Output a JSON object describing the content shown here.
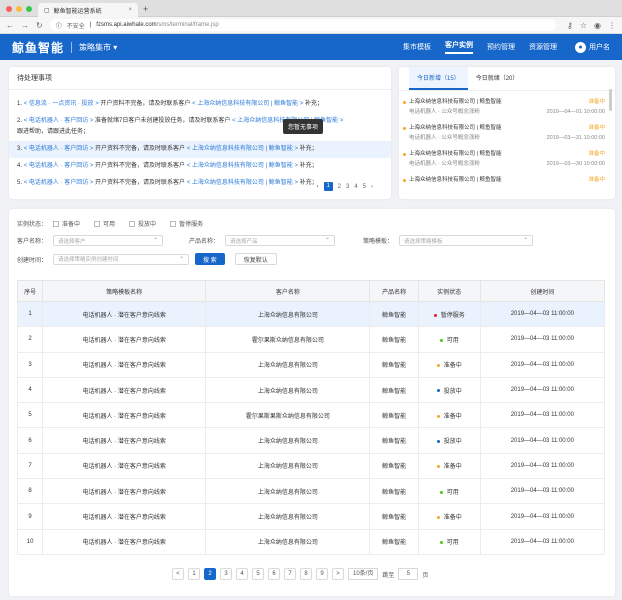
{
  "browser": {
    "tab_title": "鲸鱼智能运营系统",
    "insecure": "不安全",
    "url_host": "fzsms.api.aiwhale.com",
    "url_path": "/sms/terminal/frame.jsp"
  },
  "header": {
    "logo": "鲸鱼智能",
    "market": "策略集市",
    "nav": [
      "集市模板",
      "客户实例",
      "预约管理",
      "资源管理"
    ],
    "user": "用户名"
  },
  "todo": {
    "title": "待处理事项",
    "tooltip": "您暂无事项",
    "items": [
      {
        "n": "1.",
        "a": "< 信息流 · 一点资讯 · 投放 >",
        "b": "开户资料不完备，请及时联系客户",
        "c": "< 上海众纳信息科技有限公司 | 鲸鱼智能 >",
        "d": "补充；",
        "e": ""
      },
      {
        "n": "2.",
        "a": "< 电话机器人 · 客户回访 >",
        "b": "准备就绪7日客户未创建投放任务，请及时联系客户",
        "c": "< 上海众纳信息科技有限公司 | 鲸鱼智能 >",
        "d": "",
        "e": "跟进帮助，请跟进此任务；"
      },
      {
        "n": "3.",
        "a": "< 电话机器人 · 客户回访 >",
        "b": "开户资料不完备，请及时联系客户",
        "c": "< 上海众纳信息科技有限公司 | 鲸鱼智能 >",
        "d": "补充；",
        "e": ""
      },
      {
        "n": "4.",
        "a": "< 电话机器人 · 客户回访 >",
        "b": "开户资料不完备，请及时联系客户",
        "c": "< 上海众纳信息科技有限公司 | 鲸鱼智能 >",
        "d": "补充；",
        "e": ""
      },
      {
        "n": "5.",
        "a": "< 电话机器人 · 客户回访 >",
        "b": "开户资料不完备，请及时联系客户",
        "c": "< 上海众纳信息科技有限公司 | 鲸鱼智能 >",
        "d": "补充；",
        "e": ""
      }
    ],
    "pages": [
      "1",
      "2",
      "3",
      "4",
      "5"
    ]
  },
  "news": {
    "tab1": "今日新增（15）",
    "tab2": "今日就绪（20）",
    "items": [
      {
        "t": "上海众纳信息科技有限公司 | 鲸鱼智能",
        "s": "准备中",
        "sub": "电话机器人 · 公众号概念涨粉",
        "d": "2019—04—01 10:00:00"
      },
      {
        "t": "上海众纳信息科技有限公司 | 鲸鱼智能",
        "s": "准备中",
        "sub": "电话机器人 · 公众号概念涨粉",
        "d": "2019—03—31 10:00:00"
      },
      {
        "t": "上海众纳信息科技有限公司 | 鲸鱼智能",
        "s": "准备中",
        "sub": "电话机器人 · 公众号概念涨粉",
        "d": "2019—03—30 10:00:00"
      },
      {
        "t": "上海众纳信息科技有限公司 | 鲸鱼智能",
        "s": "准备中",
        "sub": "",
        "d": ""
      }
    ]
  },
  "filters": {
    "status_label": "实例状态：",
    "status_opts": [
      "准备中",
      "可用",
      "投放中",
      "暂停服务"
    ],
    "customer_label": "客户名称：",
    "customer_ph": "请选择客户",
    "product_label": "产品名称：",
    "product_ph": "请选择产品",
    "template_label": "策略模板：",
    "template_ph": "请选择策略模板",
    "time_label": "创建时间：",
    "time_ph": "请选择策略实例创建时间",
    "search": "搜 索",
    "reset": "恢复默认"
  },
  "table": {
    "headers": [
      "序号",
      "策略模板名称",
      "客户名称",
      "产品名称",
      "实例状态",
      "创建时间"
    ],
    "rows": [
      [
        "1",
        "电话机器人 · 潜在客户意向线索",
        "上海众纳信息有限公司",
        "鲸鱼智能",
        "暂停服务",
        "2019—04—03  11:00:00"
      ],
      [
        "2",
        "电话机器人 · 潜在客户意向线索",
        "霍尔果斯众纳信息有限公司",
        "鲸鱼智能",
        "可用",
        "2019—04—03  11:00:00"
      ],
      [
        "3",
        "电话机器人 · 潜在客户意向线索",
        "上海众纳信息有限公司",
        "鲸鱼智能",
        "准备中",
        "2019—04—03  11:00:00"
      ],
      [
        "4",
        "电话机器人 · 潜在客户意向线索",
        "上海众纳信息有限公司",
        "鲸鱼智能",
        "投放中",
        "2019—04—03  11:00:00"
      ],
      [
        "5",
        "电话机器人 · 潜在客户意向线索",
        "霍尔果斯果斯众纳信息有限公司",
        "鲸鱼智能",
        "准备中",
        "2019—04—03  11:00:00"
      ],
      [
        "6",
        "电话机器人 · 潜在客户意向线索",
        "上海众纳信息有限公司",
        "鲸鱼智能",
        "投放中",
        "2019—04—03  11:00:00"
      ],
      [
        "7",
        "电话机器人 · 潜在客户意向线索",
        "上海众纳信息有限公司",
        "鲸鱼智能",
        "准备中",
        "2019—04—03  11:00:00"
      ],
      [
        "8",
        "电话机器人 · 潜在客户意向线索",
        "上海众纳信息有限公司",
        "鲸鱼智能",
        "可用",
        "2019—04—03  11:00:00"
      ],
      [
        "9",
        "电话机器人 · 潜在客户意向线索",
        "上海众纳信息有限公司",
        "鲸鱼智能",
        "准备中",
        "2019—04—03  11:00:00"
      ],
      [
        "10",
        "电话机器人 · 潜在客户意向线索",
        "上海众纳信息有限公司",
        "鲸鱼智能",
        "可用",
        "2019—04—03  11:00:00"
      ]
    ]
  },
  "status_colors": {
    "暂停服务": "#e02020",
    "可用": "#52c41a",
    "准备中": "#f5a623",
    "投放中": "#1766c9"
  },
  "pager": {
    "prev": "<",
    "next": ">",
    "pages": [
      "1",
      "2",
      "3",
      "4",
      "5",
      "6",
      "7",
      "8",
      "9"
    ],
    "page_size": "10条/页",
    "goto": "跳至",
    "goto_val": "5",
    "page_unit": "页"
  }
}
